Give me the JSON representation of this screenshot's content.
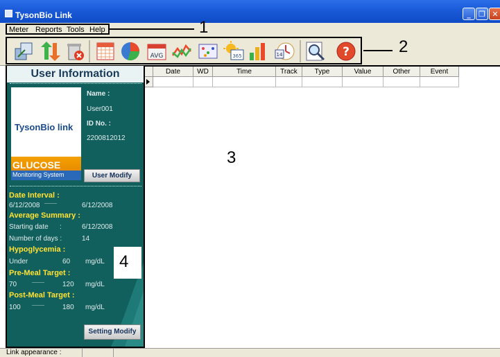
{
  "window": {
    "title": "TysonBio Link"
  },
  "menu": [
    "Meter",
    "Reports",
    "Tools",
    "Help"
  ],
  "callouts": [
    "1",
    "2",
    "3",
    "4"
  ],
  "toolbar_icons": [
    "export-icon",
    "transfer-icon",
    "delete-icon",
    "calendar-icon",
    "pie-chart-icon",
    "average-icon",
    "trend-icon",
    "daily-icon",
    "365-icon",
    "bar-chart-icon",
    "14-day-icon",
    "search-icon",
    "help-icon"
  ],
  "toolbar_avg_label": "AVG",
  "toolbar_365_label": "365",
  "toolbar_14_label": "14",
  "toolbar_help_label": "?",
  "sidebar": {
    "heading": "User Information",
    "name_label": "Name :",
    "name_value": "User001",
    "id_label": "ID No. :",
    "id_value": "2200812012",
    "logo_brand": "TysonBio link",
    "logo_glucose": "GLUCOSE",
    "logo_system": "Monitoring System",
    "user_modify_button": "User Modify",
    "date_interval_title": "Date Interval :",
    "date_from": "6/12/2008",
    "date_sep": "---------",
    "date_to": "6/12/2008",
    "average_title": "Average Summary :",
    "starting_label": "Starting date",
    "colon": ":",
    "starting_value": "6/12/2008",
    "days_label": "Number of days :",
    "days_value": "14",
    "hypo_title": "Hypoglycemia :",
    "under_label": "Under",
    "under_value": "60",
    "unit": "mg/dL",
    "pre_title": "Pre-Meal Target :",
    "pre_low": "70",
    "pre_high": "120",
    "post_title": "Post-Meal Target :",
    "post_low": "100",
    "post_high": "180",
    "range_sep": "---------",
    "setting_modify_button": "Setting Modify"
  },
  "table": {
    "columns": [
      "Date",
      "WD",
      "Time",
      "Track",
      "Type",
      "Value",
      "Other",
      "Event"
    ]
  },
  "status": {
    "text": "Link appearance :"
  },
  "colors": {
    "titlebar": "#1a5ad8",
    "sidebar": "#12605e",
    "accent_yellow": "#ffe233"
  }
}
